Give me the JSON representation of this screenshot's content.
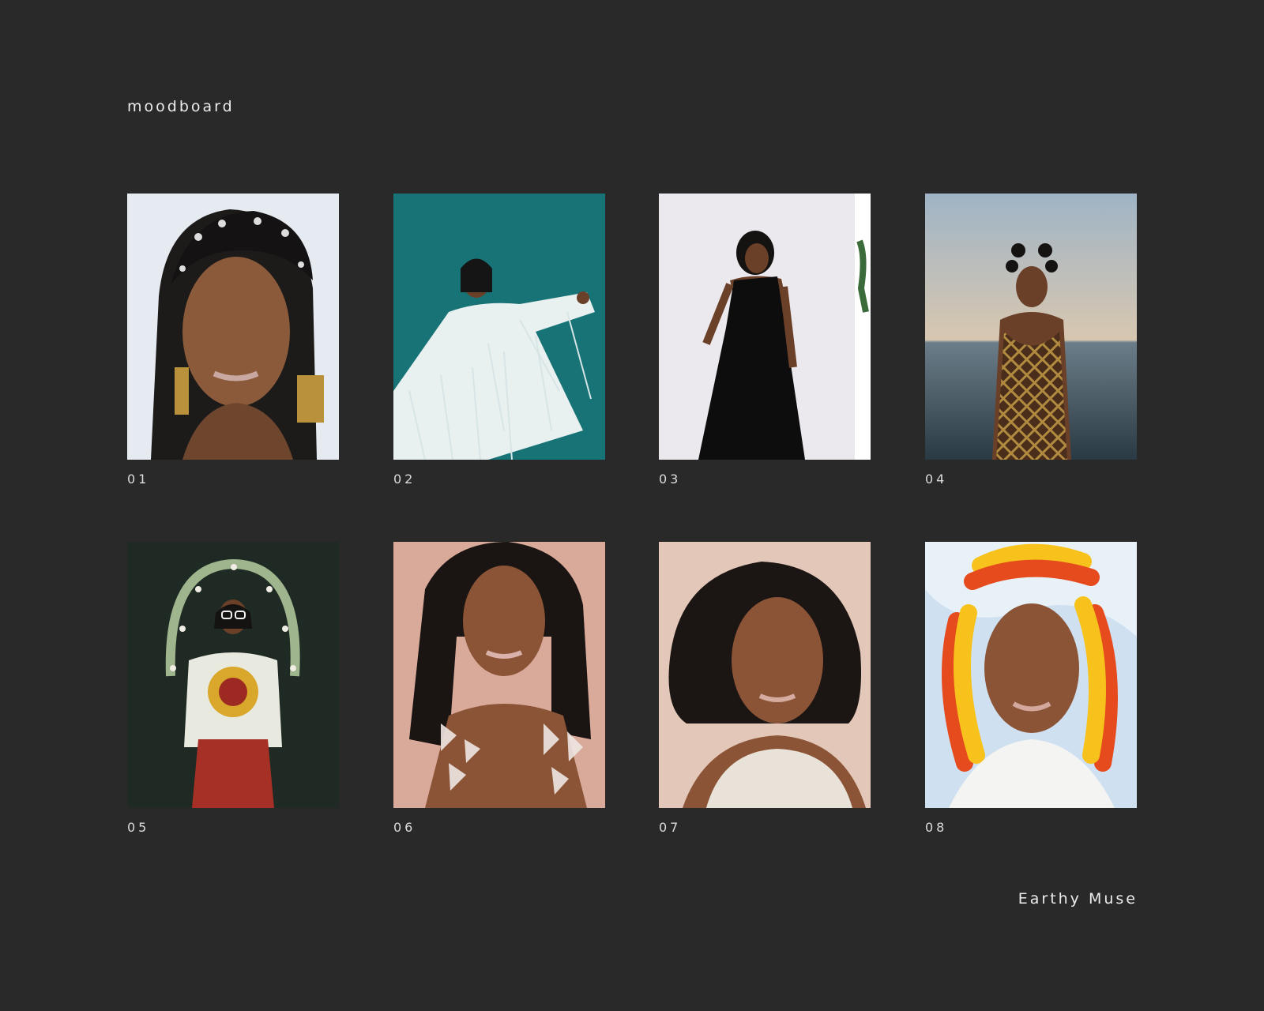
{
  "board": {
    "title": "moodboard",
    "subtitle": "Earthy Muse"
  },
  "tiles": [
    {
      "number": "01"
    },
    {
      "number": "02"
    },
    {
      "number": "03"
    },
    {
      "number": "04"
    },
    {
      "number": "05"
    },
    {
      "number": "06"
    },
    {
      "number": "07"
    },
    {
      "number": "08"
    }
  ],
  "colors": {
    "background": "#292929",
    "text": "#ececec"
  }
}
